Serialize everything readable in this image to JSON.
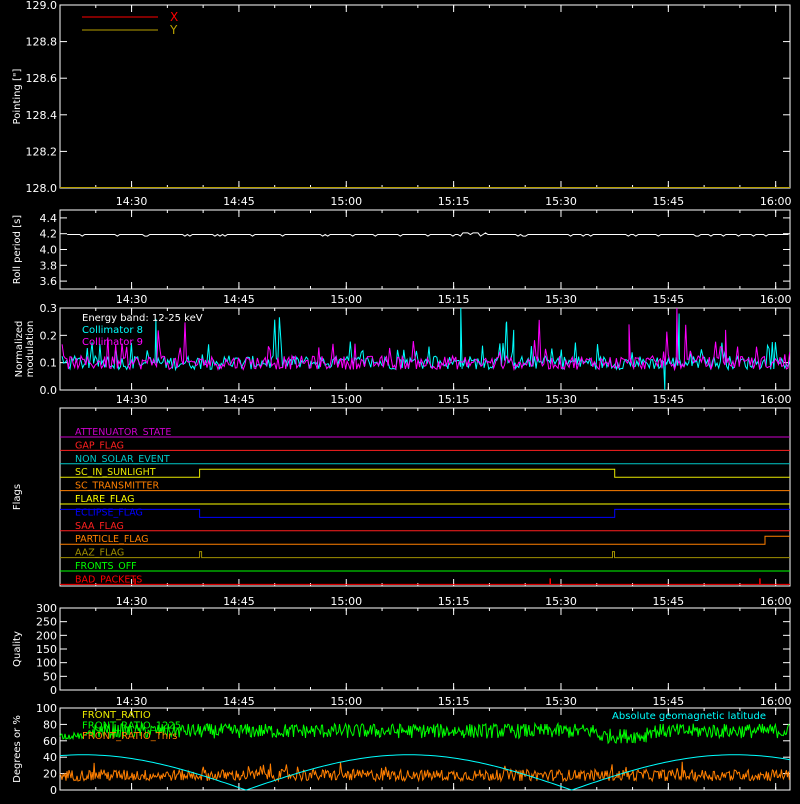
{
  "chart_data": [
    {
      "type": "line",
      "ylabel": "Pointing [\"]",
      "ylim": [
        128.0,
        129.0
      ],
      "yticks": [
        "128.0",
        "128.2",
        "128.4",
        "128.6",
        "128.8",
        "129.0"
      ],
      "xticks": [
        "14:30",
        "14:45",
        "15:00",
        "15:15",
        "15:30",
        "15:45",
        "16:00"
      ],
      "legend": [
        {
          "name": "X",
          "color": "#ff0000"
        },
        {
          "name": "Y",
          "color": "#b8a000"
        }
      ],
      "series": [
        {
          "name": "X",
          "color": "#ff0000",
          "values": []
        },
        {
          "name": "Y",
          "color": "#b8a000",
          "values": []
        }
      ]
    },
    {
      "type": "line",
      "ylabel": "Roll period [s]",
      "ylim": [
        3.5,
        4.5
      ],
      "yticks": [
        "3.6",
        "3.8",
        "4.0",
        "4.2",
        "4.4"
      ],
      "xticks": [
        "14:30",
        "14:45",
        "15:00",
        "15:15",
        "15:30",
        "15:45",
        "16:00"
      ],
      "series": [
        {
          "color": "#ffffff",
          "mean": 4.19,
          "dips": 4.17
        }
      ]
    },
    {
      "type": "line",
      "ylabel": "Normalized modulation",
      "ylabel_lines": [
        "Normalized",
        "modulation"
      ],
      "ylim": [
        0.0,
        0.3
      ],
      "yticks": [
        "0.0",
        "0.1",
        "0.2",
        "0.3"
      ],
      "xticks": [
        "14:30",
        "14:45",
        "15:00",
        "15:15",
        "15:30",
        "15:45",
        "16:00"
      ],
      "annotation": "Energy band: 12-25 keV",
      "series": [
        {
          "name": "Collimator 8",
          "color": "#00ffff",
          "baseline": 0.1
        },
        {
          "name": "Collimator 9",
          "color": "#ff00ff",
          "baseline": 0.1
        }
      ]
    },
    {
      "type": "line",
      "ylabel": "Flags",
      "xticks": [
        "14:30",
        "14:45",
        "15:00",
        "15:15",
        "15:30",
        "15:45",
        "16:00"
      ],
      "flags": [
        {
          "name": "ATTENUATOR_STATE",
          "color": "#cc00cc"
        },
        {
          "name": "GAP_FLAG",
          "color": "#ff2020"
        },
        {
          "name": "NON_SOLAR_EVENT",
          "color": "#00c8c8"
        },
        {
          "name": "SC_IN_SUNLIGHT",
          "color": "#e8e800"
        },
        {
          "name": "SC_TRANSMITTER",
          "color": "#ff7f00"
        },
        {
          "name": "FLARE_FLAG",
          "color": "#ffff00"
        },
        {
          "name": "ECLIPSE_FLAG",
          "color": "#0000ff"
        },
        {
          "name": "SAA_FLAG",
          "color": "#ff2020"
        },
        {
          "name": "PARTICLE_FLAG",
          "color": "#ff7f00"
        },
        {
          "name": "AAZ_FLAG",
          "color": "#a09000"
        },
        {
          "name": "FRONTS_OFF",
          "color": "#00ff00"
        },
        {
          "name": "BAD_PACKETS",
          "color": "#ff0000"
        }
      ]
    },
    {
      "type": "line",
      "ylabel": "Quality",
      "ylim": [
        0,
        300
      ],
      "yticks": [
        "0",
        "50",
        "100",
        "150",
        "200",
        "250",
        "300"
      ],
      "xticks": [
        "14:30",
        "14:45",
        "15:00",
        "15:15",
        "15:30",
        "15:45",
        "16:00"
      ],
      "series": []
    },
    {
      "type": "line",
      "ylabel": "Degrees or %",
      "ylim": [
        0,
        100
      ],
      "yticks": [
        "0",
        "20",
        "40",
        "60",
        "80",
        "100"
      ],
      "legend": [
        {
          "name": "FRONT_RATIO",
          "color": "#e8e800"
        },
        {
          "name": "FRONT_RATIO_1225",
          "color": "#00ff00"
        },
        {
          "name": "FRONT_RATIO_Thrs",
          "color": "#ff7f00"
        }
      ],
      "annotation": "Absolute geomagnetic latitude",
      "annotation_color": "#00ffff",
      "series": [
        {
          "name": "FRONT_RATIO_1225",
          "color": "#00ff00",
          "mean": 72
        },
        {
          "name": "FRONT_RATIO_Thrs",
          "color": "#ff7f00",
          "mean": 18
        },
        {
          "name": "Absolute geomagnetic latitude",
          "color": "#00ffff"
        }
      ]
    }
  ]
}
